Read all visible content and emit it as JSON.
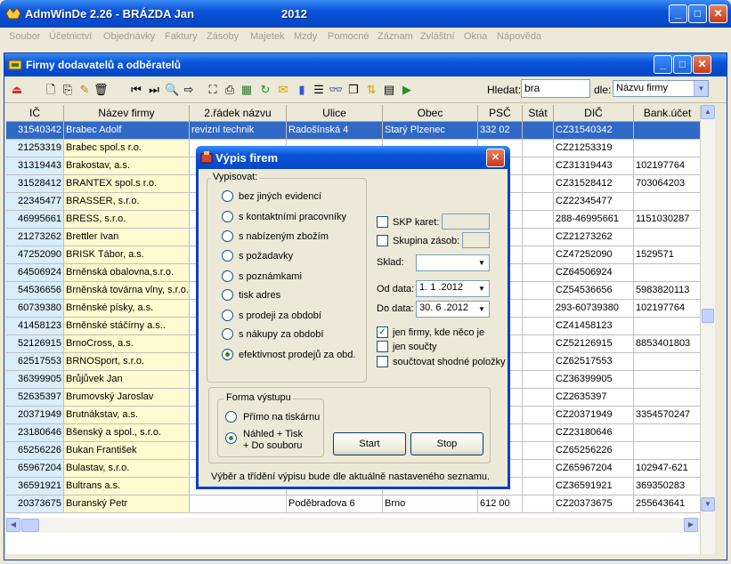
{
  "window": {
    "title": "AdmWinDe 2.26 - BRÁZDA Jan",
    "year": "2012"
  },
  "menu": [
    "Soubor",
    "Účetnictví",
    "Objednávky",
    "Faktury",
    "Zásoby",
    "Majetek",
    "Mzdy",
    "Pomocné",
    "Záznam",
    "Zvláštní",
    "Okna",
    "Nápověda"
  ],
  "subwindow": {
    "title": "Firmy dodavatelů a odběratelů"
  },
  "search": {
    "label": "Hledat:",
    "value": "bra",
    "by_label": "dle:",
    "by_value": "Názvu firmy"
  },
  "columns": [
    "IČ",
    "Název firmy",
    "2.řádek názvu",
    "Ulice",
    "Obec",
    "PSČ",
    "Stát",
    "DIČ",
    "Bank.účet"
  ],
  "rows": [
    [
      "31540342",
      "Brabec Adolf",
      "revizní technik",
      "Radošínská 4",
      "Starý Plzenec",
      "332 02",
      "",
      "CZ31540342",
      ""
    ],
    [
      "21253319",
      "Brabec spol.s r.o.",
      "",
      "",
      "",
      "",
      "",
      "CZ21253319",
      ""
    ],
    [
      "31319443",
      "Brakostav, a.s.",
      "",
      "",
      "",
      "",
      "",
      "CZ31319443",
      "102197764"
    ],
    [
      "31528412",
      "BRANTEX  spol.s r.o.",
      "",
      "",
      "",
      "",
      "",
      "CZ31528412",
      "703064203"
    ],
    [
      "22345477",
      "BRASSER, s.r.o.",
      "",
      "",
      "",
      "",
      "",
      "CZ22345477",
      ""
    ],
    [
      "46995661",
      "BRESS, s.r.o.",
      "",
      "",
      "",
      "",
      "",
      "288-46995661",
      "1151030287"
    ],
    [
      "21273262",
      "Brettler Ivan",
      "",
      "",
      "",
      "",
      "",
      "CZ21273262",
      ""
    ],
    [
      "47252090",
      "BRISK Tábor, a.s.",
      "",
      "",
      "",
      "",
      "",
      "CZ47252090",
      "1529571"
    ],
    [
      "64506924",
      "Brněnská obalovna,s.r.o.",
      "",
      "",
      "",
      "",
      "",
      "CZ64506924",
      ""
    ],
    [
      "54536656",
      "Brněnská továrna vlny, s.r.o.",
      "",
      "",
      "",
      "",
      "",
      "CZ54536656",
      "5983820113"
    ],
    [
      "60739380",
      "Brněnské písky, a.s.",
      "",
      "",
      "",
      "",
      "",
      "293-60739380",
      "102197764"
    ],
    [
      "41458123",
      "Brněnské stáčírny a.s..",
      "",
      "",
      "",
      "",
      "",
      "CZ41458123",
      ""
    ],
    [
      "52126915",
      "BrnoCross, a.s.",
      "",
      "",
      "",
      "",
      "",
      "CZ52126915",
      "8853401803"
    ],
    [
      "62517553",
      "BRNOSport, s.r.o.",
      "",
      "",
      "",
      "",
      "",
      "CZ62517553",
      ""
    ],
    [
      "36399905",
      "Brůjůvek Jan",
      "",
      "",
      "",
      "",
      "",
      "CZ36399905",
      ""
    ],
    [
      "52635397",
      "Brumovský Jaroslav",
      "",
      "",
      "",
      "",
      "",
      "CZ2635397",
      ""
    ],
    [
      "20371949",
      "Brutnákstav, a.s.",
      "",
      "",
      "",
      "",
      "",
      "CZ20371949",
      "3354570247"
    ],
    [
      "23180646",
      "Bšenský a spol., s.r.o.",
      "",
      "",
      "",
      "",
      "",
      "CZ23180646",
      ""
    ],
    [
      "65256226",
      "Bukan František",
      "",
      "",
      "",
      "",
      "",
      "CZ65256226",
      ""
    ],
    [
      "65967204",
      "Bulastav, s.r.o.",
      "",
      "",
      "",
      "",
      "",
      "CZ65967204",
      "102947-621"
    ],
    [
      "36591921",
      "Bultrans a.s.",
      "",
      "",
      "",
      "",
      "",
      "CZ36591921",
      "369350283"
    ],
    [
      "20373675",
      "Buranský Petr",
      "",
      "Poděbradova 6",
      "Brno",
      "612 00",
      "",
      "CZ20373675",
      "255643641"
    ]
  ],
  "dialog": {
    "title": "Výpis firem",
    "group_label": "Vypisovat:",
    "options": [
      "bez jiných evidencí",
      "s kontaktními pracovníky",
      "s nabízeným zbožím",
      "s požadavky",
      "s poznámkami",
      "tisk adres",
      "s prodeji za období",
      "s nákupy za období",
      "efektivnost prodejů za obd."
    ],
    "selected_option": "efektivnost prodejů za obd.",
    "skp_label": "SKP karet:",
    "skupina_label": "Skupina zásob:",
    "sklad_label": "Sklad:",
    "od_label": "Od data:",
    "od_value": "1. 1 .2012",
    "do_label": "Do data:",
    "do_value": "30. 6 .2012",
    "chk_jen_firmy": "jen firmy, kde něco je",
    "chk_jen_soucty": "jen součty",
    "chk_scitat": "součtovat shodné položky",
    "forma_label": "Forma výstupu",
    "out_printer": "Přímo na tiskárnu",
    "out_preview_1": "Náhled + Tisk",
    "out_preview_2": "+ Do souboru",
    "start": "Start",
    "stop": "Stop",
    "note": "Výběr a třídění výpisu bude dle aktuálně nastaveného seznamu."
  },
  "colors": {
    "selected_row": "#3169c6",
    "ic_column": "#d9edfb",
    "name_column": "#fffacf",
    "title_bar": "#0a53d8"
  }
}
